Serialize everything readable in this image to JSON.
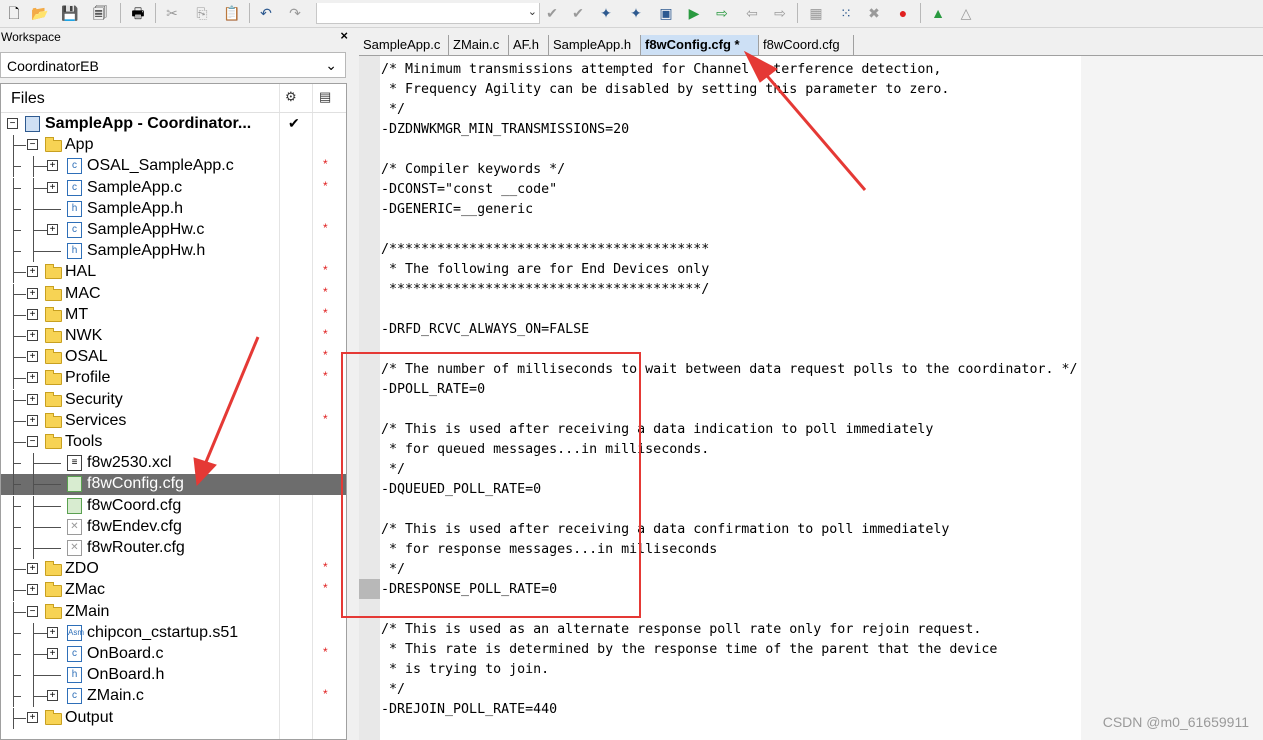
{
  "toolbar": {
    "icons": [
      "new-file-icon",
      "open-icon",
      "save-icon",
      "save-all-icon",
      "print-icon",
      "cut-icon",
      "copy-icon",
      "paste-icon",
      "undo-icon",
      "redo-icon",
      "dropdown-icon",
      "toggle-bookmark-icon",
      "next-bookmark-icon",
      "find-icon",
      "find-next-icon",
      "go-to-icon",
      "compile-icon",
      "make-icon",
      "rebuild-icon",
      "clean-icon",
      "batch-build-icon",
      "stop-build-icon",
      "breakpoint-icon",
      "debug-icon",
      "download-icon"
    ]
  },
  "workspace": {
    "title": "Workspace",
    "close": "×",
    "config": "CoordinatorEB",
    "files_header": "Files",
    "tree": [
      {
        "label": "SampleApp - Coordinator...",
        "level": 0,
        "type": "project",
        "expander": "−",
        "check": "✔",
        "bold": true
      },
      {
        "label": "App",
        "level": 1,
        "type": "folder",
        "expander": "−"
      },
      {
        "label": "OSAL_SampleApp.c",
        "level": 2,
        "type": "c",
        "expander": "+",
        "mark": "*"
      },
      {
        "label": "SampleApp.c",
        "level": 2,
        "type": "c",
        "expander": "+",
        "mark": "*"
      },
      {
        "label": "SampleApp.h",
        "level": 2,
        "type": "h",
        "expander": ""
      },
      {
        "label": "SampleAppHw.c",
        "level": 2,
        "type": "c",
        "expander": "+",
        "mark": "*"
      },
      {
        "label": "SampleAppHw.h",
        "level": 2,
        "type": "h",
        "expander": ""
      },
      {
        "label": "HAL",
        "level": 1,
        "type": "folder",
        "expander": "+",
        "mark": "*"
      },
      {
        "label": "MAC",
        "level": 1,
        "type": "folder",
        "expander": "+",
        "mark": "*"
      },
      {
        "label": "MT",
        "level": 1,
        "type": "folder",
        "expander": "+",
        "mark": "*"
      },
      {
        "label": "NWK",
        "level": 1,
        "type": "folder",
        "expander": "+",
        "mark": "*"
      },
      {
        "label": "OSAL",
        "level": 1,
        "type": "folder",
        "expander": "+",
        "mark": "*"
      },
      {
        "label": "Profile",
        "level": 1,
        "type": "folder",
        "expander": "+",
        "mark": "*"
      },
      {
        "label": "Security",
        "level": 1,
        "type": "folder",
        "expander": "+"
      },
      {
        "label": "Services",
        "level": 1,
        "type": "folder",
        "expander": "+",
        "mark": "*"
      },
      {
        "label": "Tools",
        "level": 1,
        "type": "folder",
        "expander": "−"
      },
      {
        "label": "f8w2530.xcl",
        "level": 2,
        "type": "xcl",
        "expander": ""
      },
      {
        "label": "f8wConfig.cfg",
        "level": 2,
        "type": "cfg",
        "expander": "",
        "selected": true
      },
      {
        "label": "f8wCoord.cfg",
        "level": 2,
        "type": "cfg",
        "expander": ""
      },
      {
        "label": "f8wEndev.cfg",
        "level": 2,
        "type": "excluded",
        "expander": ""
      },
      {
        "label": "f8wRouter.cfg",
        "level": 2,
        "type": "excluded",
        "expander": ""
      },
      {
        "label": "ZDO",
        "level": 1,
        "type": "folder",
        "expander": "+",
        "mark": "*"
      },
      {
        "label": "ZMac",
        "level": 1,
        "type": "folder",
        "expander": "+",
        "mark": "*"
      },
      {
        "label": "ZMain",
        "level": 1,
        "type": "folder",
        "expander": "−"
      },
      {
        "label": "chipcon_cstartup.s51",
        "level": 2,
        "type": "asm",
        "expander": "+"
      },
      {
        "label": "OnBoard.c",
        "level": 2,
        "type": "c",
        "expander": "+",
        "mark": "*"
      },
      {
        "label": "OnBoard.h",
        "level": 2,
        "type": "h",
        "expander": ""
      },
      {
        "label": "ZMain.c",
        "level": 2,
        "type": "c",
        "expander": "+",
        "mark": "*"
      },
      {
        "label": "Output",
        "level": 1,
        "type": "folder",
        "expander": "+"
      }
    ]
  },
  "editor": {
    "tabs": [
      {
        "label": "SampleApp.c",
        "active": false
      },
      {
        "label": "ZMain.c",
        "active": false
      },
      {
        "label": "AF.h",
        "active": false
      },
      {
        "label": "SampleApp.h",
        "active": false
      },
      {
        "label": "f8wConfig.cfg *",
        "active": true
      },
      {
        "label": "f8wCoord.cfg",
        "active": false
      }
    ],
    "code": "/* Minimum transmissions attempted for Channel Interference detection,\n * Frequency Agility can be disabled by setting this parameter to zero.\n */\n-DZDNWKMGR_MIN_TRANSMISSIONS=20\n\n/* Compiler keywords */\n-DCONST=\"const __code\"\n-DGENERIC=__generic\n\n/****************************************\n * The following are for End Devices only\n ***************************************/\n\n-DRFD_RCVC_ALWAYS_ON=FALSE\n\n/* The number of milliseconds to wait between data request polls to the coordinator. */\n-DPOLL_RATE=0\n\n/* This is used after receiving a data indication to poll immediately\n * for queued messages...in milliseconds.\n */\n-DQUEUED_POLL_RATE=0\n\n/* This is used after receiving a data confirmation to poll immediately\n * for response messages...in milliseconds\n */\n-DRESPONSE_POLL_RATE=0\n\n/* This is used as an alternate response poll rate only for rejoin request.\n * This rate is determined by the response time of the parent that the device\n * is trying to join.\n */\n-DREJOIN_POLL_RATE=440"
  },
  "watermark": "CSDN @m0_61659911",
  "colors": {
    "annotation_red": "#e53935",
    "selected_row": "#6d6d6d",
    "active_tab": "#cde0f5"
  }
}
